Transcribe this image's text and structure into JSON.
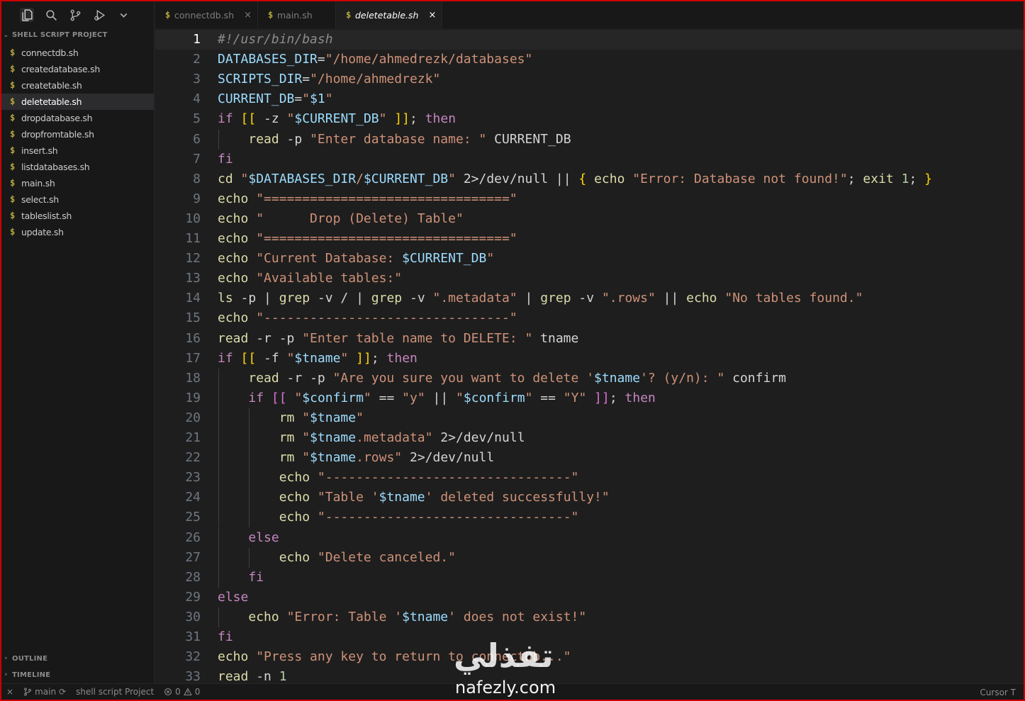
{
  "explorer": {
    "section_title": "SHELL SCRIPT PROJECT",
    "files": [
      {
        "name": "connectdb.sh",
        "selected": false
      },
      {
        "name": "createdatabase.sh",
        "selected": false
      },
      {
        "name": "createtable.sh",
        "selected": false
      },
      {
        "name": "deletetable.sh",
        "selected": true
      },
      {
        "name": "dropdatabase.sh",
        "selected": false
      },
      {
        "name": "dropfromtable.sh",
        "selected": false
      },
      {
        "name": "insert.sh",
        "selected": false
      },
      {
        "name": "listdatabases.sh",
        "selected": false
      },
      {
        "name": "main.sh",
        "selected": false
      },
      {
        "name": "select.sh",
        "selected": false
      },
      {
        "name": "tableslist.sh",
        "selected": false
      },
      {
        "name": "update.sh",
        "selected": false
      }
    ],
    "outline_title": "OUTLINE",
    "timeline_title": "TIMELINE",
    "file_icon": "$"
  },
  "activity_icons": [
    "explorer-icon",
    "search-icon",
    "source-control-icon",
    "run-debug-icon",
    "chevron-down-icon"
  ],
  "tabs": [
    {
      "label": "connectdb.sh",
      "active": false,
      "close": "×"
    },
    {
      "label": "main.sh",
      "active": false,
      "close": ""
    },
    {
      "label": "deletetable.sh",
      "active": true,
      "close": "×"
    }
  ],
  "editor": {
    "current_line": 1,
    "lines": [
      [
        [
          "c-com",
          "#!/usr/bin/bash"
        ]
      ],
      [
        [
          "c-var",
          "DATABASES_DIR"
        ],
        [
          "c-op",
          "="
        ],
        [
          "c-str",
          "\"/home/ahmedrezk/databases\""
        ]
      ],
      [
        [
          "c-var",
          "SCRIPTS_DIR"
        ],
        [
          "c-op",
          "="
        ],
        [
          "c-str",
          "\"/home/ahmedrezk\""
        ]
      ],
      [
        [
          "c-var",
          "CURRENT_DB"
        ],
        [
          "c-op",
          "="
        ],
        [
          "c-str",
          "\""
        ],
        [
          "c-var",
          "$1"
        ],
        [
          "c-str",
          "\""
        ]
      ],
      [
        [
          "c-ctl",
          "if"
        ],
        [
          "c-op",
          " "
        ],
        [
          "c-brk",
          "[["
        ],
        [
          "c-op",
          " -z "
        ],
        [
          "c-str",
          "\""
        ],
        [
          "c-var",
          "$CURRENT_DB"
        ],
        [
          "c-str",
          "\""
        ],
        [
          "c-op",
          " "
        ],
        [
          "c-brk",
          "]]"
        ],
        [
          "c-op",
          "; "
        ],
        [
          "c-ctl",
          "then"
        ]
      ],
      [
        [
          "c-op",
          "    "
        ],
        [
          "c-cmd",
          "read"
        ],
        [
          "c-op",
          " -p "
        ],
        [
          "c-str",
          "\"Enter database name: \""
        ],
        [
          "c-op",
          " CURRENT_DB"
        ]
      ],
      [
        [
          "c-ctl",
          "fi"
        ]
      ],
      [
        [
          "c-cmd",
          "cd"
        ],
        [
          "c-op",
          " "
        ],
        [
          "c-str",
          "\""
        ],
        [
          "c-var",
          "$DATABASES_DIR"
        ],
        [
          "c-str",
          "/"
        ],
        [
          "c-var",
          "$CURRENT_DB"
        ],
        [
          "c-str",
          "\""
        ],
        [
          "c-op",
          " 2>/dev/null || "
        ],
        [
          "c-brk",
          "{"
        ],
        [
          "c-op",
          " "
        ],
        [
          "c-cmd",
          "echo"
        ],
        [
          "c-op",
          " "
        ],
        [
          "c-str",
          "\"Error: Database not found!\""
        ],
        [
          "c-op",
          "; "
        ],
        [
          "c-cmd",
          "exit"
        ],
        [
          "c-op",
          " "
        ],
        [
          "c-num",
          "1"
        ],
        [
          "c-op",
          "; "
        ],
        [
          "c-brk",
          "}"
        ]
      ],
      [
        [
          "c-cmd",
          "echo"
        ],
        [
          "c-op",
          " "
        ],
        [
          "c-str",
          "\"================================\""
        ]
      ],
      [
        [
          "c-cmd",
          "echo"
        ],
        [
          "c-op",
          " "
        ],
        [
          "c-str",
          "\"      Drop (Delete) Table\""
        ]
      ],
      [
        [
          "c-cmd",
          "echo"
        ],
        [
          "c-op",
          " "
        ],
        [
          "c-str",
          "\"================================\""
        ]
      ],
      [
        [
          "c-cmd",
          "echo"
        ],
        [
          "c-op",
          " "
        ],
        [
          "c-str",
          "\"Current Database: "
        ],
        [
          "c-var",
          "$CURRENT_DB"
        ],
        [
          "c-str",
          "\""
        ]
      ],
      [
        [
          "c-cmd",
          "echo"
        ],
        [
          "c-op",
          " "
        ],
        [
          "c-str",
          "\"Available tables:\""
        ]
      ],
      [
        [
          "c-cmd",
          "ls"
        ],
        [
          "c-op",
          " -p | "
        ],
        [
          "c-cmd",
          "grep"
        ],
        [
          "c-op",
          " -v / | "
        ],
        [
          "c-cmd",
          "grep"
        ],
        [
          "c-op",
          " -v "
        ],
        [
          "c-str",
          "\".metadata\""
        ],
        [
          "c-op",
          " | "
        ],
        [
          "c-cmd",
          "grep"
        ],
        [
          "c-op",
          " -v "
        ],
        [
          "c-str",
          "\".rows\""
        ],
        [
          "c-op",
          " || "
        ],
        [
          "c-cmd",
          "echo"
        ],
        [
          "c-op",
          " "
        ],
        [
          "c-str",
          "\"No tables found.\""
        ]
      ],
      [
        [
          "c-cmd",
          "echo"
        ],
        [
          "c-op",
          " "
        ],
        [
          "c-str",
          "\"--------------------------------\""
        ]
      ],
      [
        [
          "c-cmd",
          "read"
        ],
        [
          "c-op",
          " -r -p "
        ],
        [
          "c-str",
          "\"Enter table name to DELETE: \""
        ],
        [
          "c-op",
          " tname"
        ]
      ],
      [
        [
          "c-ctl",
          "if"
        ],
        [
          "c-op",
          " "
        ],
        [
          "c-brk",
          "[["
        ],
        [
          "c-op",
          " -f "
        ],
        [
          "c-str",
          "\""
        ],
        [
          "c-var",
          "$tname"
        ],
        [
          "c-str",
          "\""
        ],
        [
          "c-op",
          " "
        ],
        [
          "c-brk",
          "]]"
        ],
        [
          "c-op",
          "; "
        ],
        [
          "c-ctl",
          "then"
        ]
      ],
      [
        [
          "c-op",
          "    "
        ],
        [
          "c-cmd",
          "read"
        ],
        [
          "c-op",
          " -r -p "
        ],
        [
          "c-str",
          "\"Are you sure you want to delete '"
        ],
        [
          "c-var",
          "$tname"
        ],
        [
          "c-str",
          "'? (y/n): \""
        ],
        [
          "c-op",
          " confirm"
        ]
      ],
      [
        [
          "c-op",
          "    "
        ],
        [
          "c-ctl",
          "if"
        ],
        [
          "c-op",
          " "
        ],
        [
          "c-brk2",
          "[["
        ],
        [
          "c-op",
          " "
        ],
        [
          "c-str",
          "\""
        ],
        [
          "c-var",
          "$confirm"
        ],
        [
          "c-str",
          "\""
        ],
        [
          "c-op",
          " == "
        ],
        [
          "c-str",
          "\"y\""
        ],
        [
          "c-op",
          " || "
        ],
        [
          "c-str",
          "\""
        ],
        [
          "c-var",
          "$confirm"
        ],
        [
          "c-str",
          "\""
        ],
        [
          "c-op",
          " == "
        ],
        [
          "c-str",
          "\"Y\""
        ],
        [
          "c-op",
          " "
        ],
        [
          "c-brk2",
          "]]"
        ],
        [
          "c-op",
          "; "
        ],
        [
          "c-ctl",
          "then"
        ]
      ],
      [
        [
          "c-op",
          "        "
        ],
        [
          "c-cmd",
          "rm"
        ],
        [
          "c-op",
          " "
        ],
        [
          "c-str",
          "\""
        ],
        [
          "c-var",
          "$tname"
        ],
        [
          "c-str",
          "\""
        ]
      ],
      [
        [
          "c-op",
          "        "
        ],
        [
          "c-cmd",
          "rm"
        ],
        [
          "c-op",
          " "
        ],
        [
          "c-str",
          "\""
        ],
        [
          "c-var",
          "$tname"
        ],
        [
          "c-str",
          ".metadata\""
        ],
        [
          "c-op",
          " 2>/dev/null"
        ]
      ],
      [
        [
          "c-op",
          "        "
        ],
        [
          "c-cmd",
          "rm"
        ],
        [
          "c-op",
          " "
        ],
        [
          "c-str",
          "\""
        ],
        [
          "c-var",
          "$tname"
        ],
        [
          "c-str",
          ".rows\""
        ],
        [
          "c-op",
          " 2>/dev/null"
        ]
      ],
      [
        [
          "c-op",
          "        "
        ],
        [
          "c-cmd",
          "echo"
        ],
        [
          "c-op",
          " "
        ],
        [
          "c-str",
          "\"--------------------------------\""
        ]
      ],
      [
        [
          "c-op",
          "        "
        ],
        [
          "c-cmd",
          "echo"
        ],
        [
          "c-op",
          " "
        ],
        [
          "c-str",
          "\"Table '"
        ],
        [
          "c-var",
          "$tname"
        ],
        [
          "c-str",
          "' deleted successfully!\""
        ]
      ],
      [
        [
          "c-op",
          "        "
        ],
        [
          "c-cmd",
          "echo"
        ],
        [
          "c-op",
          " "
        ],
        [
          "c-str",
          "\"--------------------------------\""
        ]
      ],
      [
        [
          "c-op",
          "    "
        ],
        [
          "c-ctl",
          "else"
        ]
      ],
      [
        [
          "c-op",
          "        "
        ],
        [
          "c-cmd",
          "echo"
        ],
        [
          "c-op",
          " "
        ],
        [
          "c-str",
          "\"Delete canceled.\""
        ]
      ],
      [
        [
          "c-op",
          "    "
        ],
        [
          "c-ctl",
          "fi"
        ]
      ],
      [
        [
          "c-ctl",
          "else"
        ]
      ],
      [
        [
          "c-op",
          "    "
        ],
        [
          "c-cmd",
          "echo"
        ],
        [
          "c-op",
          " "
        ],
        [
          "c-str",
          "\"Error: Table '"
        ],
        [
          "c-var",
          "$tname"
        ],
        [
          "c-str",
          "' does not exist!\""
        ]
      ],
      [
        [
          "c-ctl",
          "fi"
        ]
      ],
      [
        [
          "c-cmd",
          "echo"
        ],
        [
          "c-op",
          " "
        ],
        [
          "c-str",
          "\"Press any key to return to connectDb...\""
        ]
      ],
      [
        [
          "c-cmd",
          "read"
        ],
        [
          "c-op",
          " -n "
        ],
        [
          "c-num",
          "1"
        ]
      ]
    ]
  },
  "statusbar": {
    "remote_icon": "×",
    "branch_label": "main",
    "sync_icon": "⟳",
    "project_label": "shell script Project",
    "errors": "0",
    "warnings": "0",
    "cursor_label": "Cursor T"
  },
  "watermark": {
    "logo_text": "تفذلي",
    "url": "nafezly.com"
  }
}
